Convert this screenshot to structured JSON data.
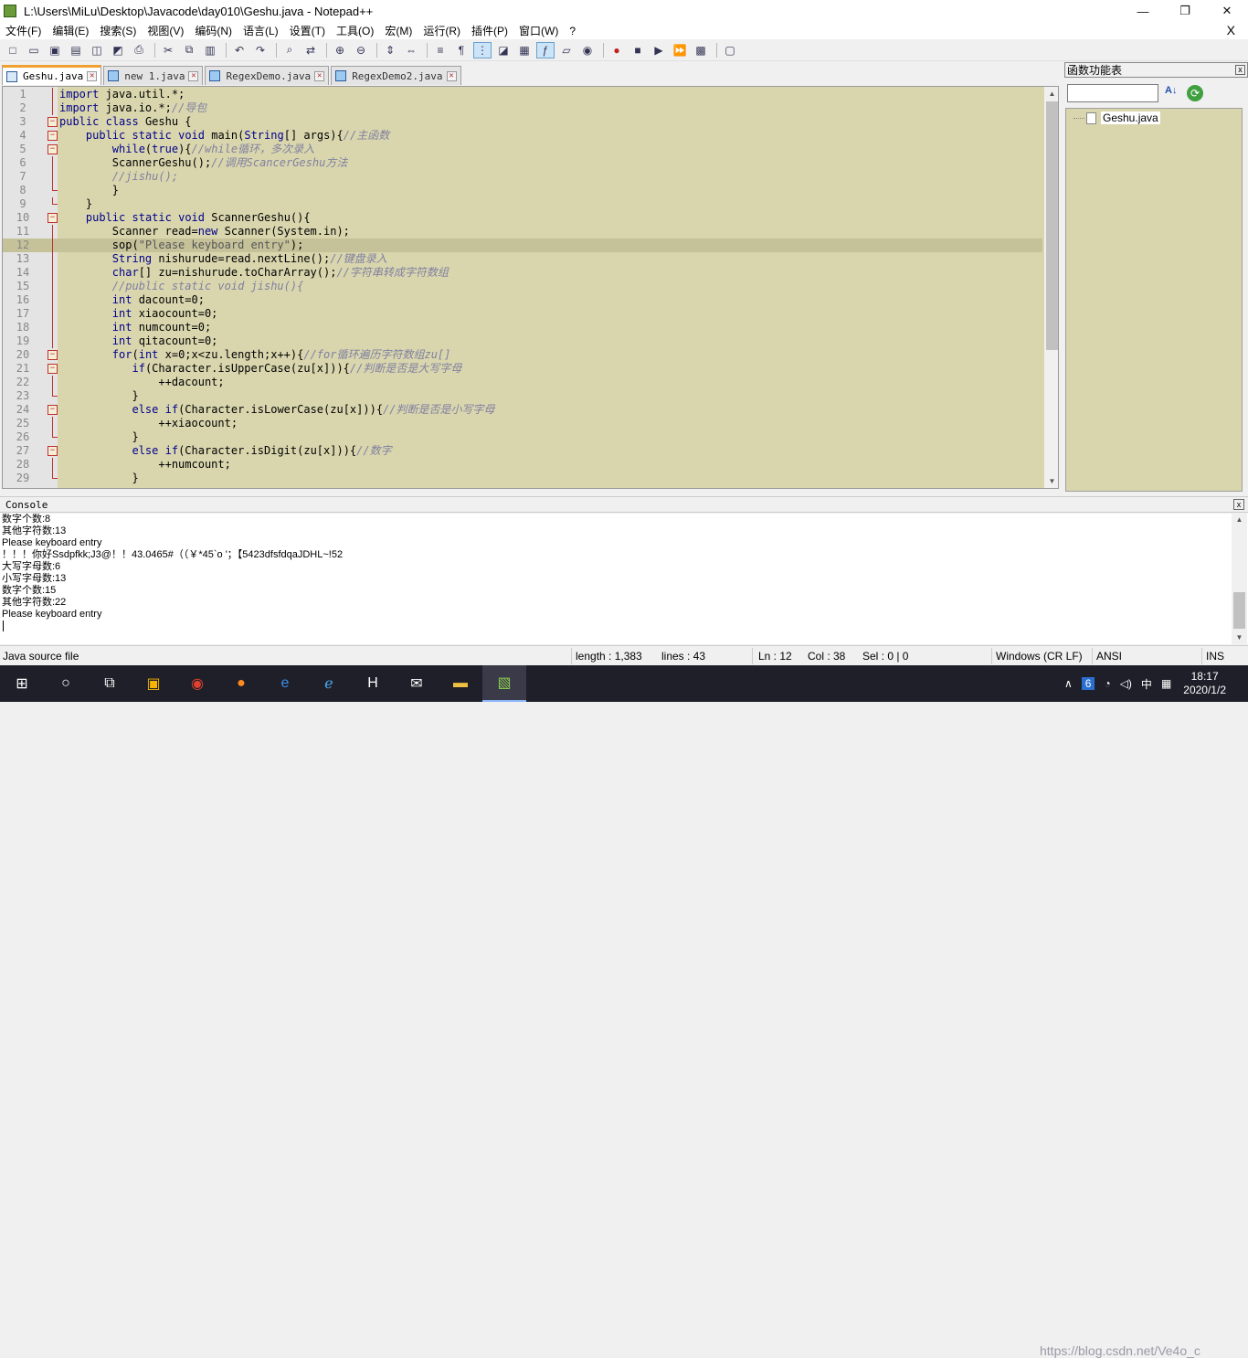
{
  "window": {
    "title": "L:\\Users\\MiLu\\Desktop\\Javacode\\day010\\Geshu.java - Notepad++"
  },
  "menu": [
    "文件(F)",
    "编辑(E)",
    "搜索(S)",
    "视图(V)",
    "编码(N)",
    "语言(L)",
    "设置(T)",
    "工具(O)",
    "宏(M)",
    "运行(R)",
    "插件(P)",
    "窗口(W)",
    "?"
  ],
  "menu_close": "X",
  "tabs": [
    {
      "label": "Geshu.java",
      "active": true
    },
    {
      "label": "new 1.java",
      "active": false
    },
    {
      "label": "RegexDemo.java",
      "active": false
    },
    {
      "label": "RegexDemo2.java",
      "active": false
    }
  ],
  "editor": {
    "current_line": 12,
    "lines": [
      {
        "n": "1",
        "code": "import java.util.*;"
      },
      {
        "n": "2",
        "code": "import java.io.*;//导包"
      },
      {
        "n": "3",
        "code": "public class Geshu {"
      },
      {
        "n": "4",
        "code": "    public static void main(String[] args){//主函数"
      },
      {
        "n": "5",
        "code": "        while(true){//while循环，多次录入"
      },
      {
        "n": "6",
        "code": "        ScannerGeshu();//调用ScancerGeshu方法"
      },
      {
        "n": "7",
        "code": "        //jishu();"
      },
      {
        "n": "8",
        "code": "        }"
      },
      {
        "n": "9",
        "code": "    }"
      },
      {
        "n": "10",
        "code": "    public static void ScannerGeshu(){"
      },
      {
        "n": "11",
        "code": "        Scanner read=new Scanner(System.in);"
      },
      {
        "n": "12",
        "code": "        sop(\"Please keyboard entry\");"
      },
      {
        "n": "13",
        "code": "        String nishurude=read.nextLine();//键盘录入"
      },
      {
        "n": "14",
        "code": "        char[] zu=nishurude.toCharArray();//字符串转成字符数组"
      },
      {
        "n": "15",
        "code": "        //public static void jishu(){"
      },
      {
        "n": "16",
        "code": "        int dacount=0;"
      },
      {
        "n": "17",
        "code": "        int xiaocount=0;"
      },
      {
        "n": "18",
        "code": "        int numcount=0;"
      },
      {
        "n": "19",
        "code": "        int qitacount=0;"
      },
      {
        "n": "20",
        "code": "        for(int x=0;x<zu.length;x++){//for循环遍历字符数组zu[]"
      },
      {
        "n": "21",
        "code": "           if(Character.isUpperCase(zu[x])){//判断是否是大写字母"
      },
      {
        "n": "22",
        "code": "               ++dacount;"
      },
      {
        "n": "23",
        "code": "           }"
      },
      {
        "n": "24",
        "code": "           else if(Character.isLowerCase(zu[x])){//判断是否是小写字母"
      },
      {
        "n": "25",
        "code": "               ++xiaocount;"
      },
      {
        "n": "26",
        "code": "           }"
      },
      {
        "n": "27",
        "code": "           else if(Character.isDigit(zu[x])){//数字"
      },
      {
        "n": "28",
        "code": "               ++numcount;"
      },
      {
        "n": "29",
        "code": "           }"
      }
    ]
  },
  "function_list": {
    "title": "函数功能表",
    "close": "x",
    "search_value": "",
    "items": [
      "Geshu.java"
    ]
  },
  "console": {
    "title": "Console",
    "close": "x",
    "lines": [
      "数字个数:8",
      "其他字符数:13",
      "Please keyboard entry",
      "！！！你好Ssdpfkk;J3@！！43.0465#（（￥*45`o '；【5423dfsfdqaJDHL~!52",
      "大写字母数:6",
      "小写字母数:13",
      "数字个数:15",
      "其他字符数:22",
      "Please keyboard entry"
    ]
  },
  "status": {
    "file_type": "Java source file",
    "length": "length : 1,383",
    "lines": "lines : 43",
    "ln": "Ln : 12",
    "col": "Col : 38",
    "sel": "Sel : 0 | 0",
    "eol": "Windows (CR LF)",
    "encoding": "ANSI",
    "mode": "INS"
  },
  "taskbar": {
    "notification_badge": "6",
    "ime": "中",
    "time": "18:17",
    "date": "2020/1/2",
    "watermark": "https://blog.csdn.net/Ve4o_c"
  }
}
